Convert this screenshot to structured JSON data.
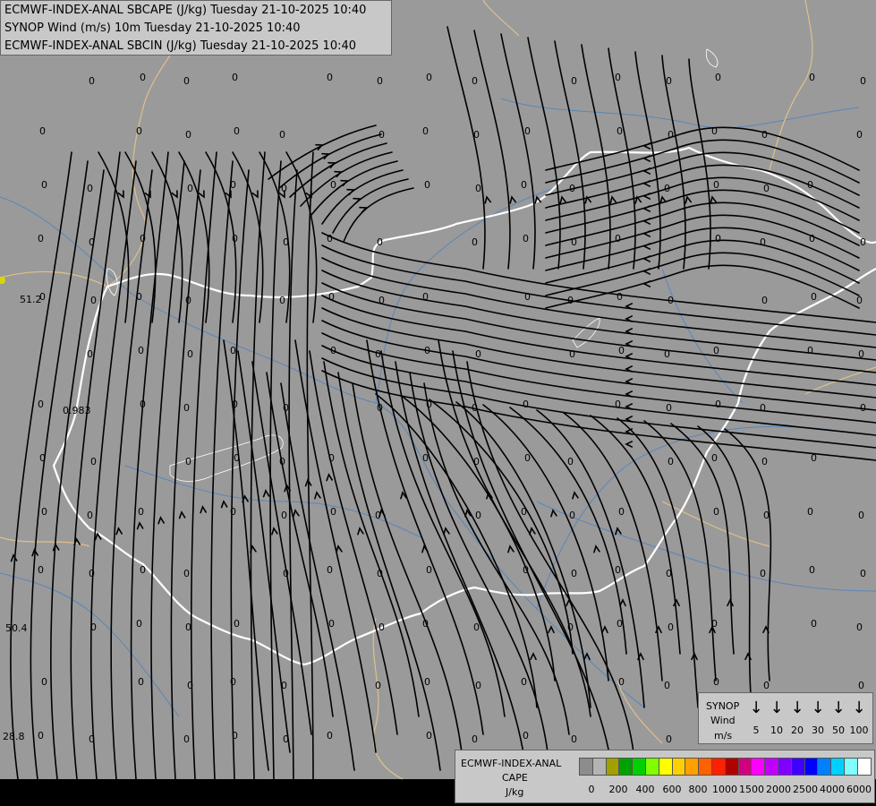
{
  "titles": {
    "line1": "ECMWF-INDEX-ANAL SBCAPE (J/kg) Tuesday 21-10-2025 10:40",
    "line2": "SYNOP Wind (m/s) 10m Tuesday 21-10-2025 10:40",
    "line3": "ECMWF-INDEX-ANAL SBCIN (J/kg) Tuesday 21-10-2025 10:40"
  },
  "colors": {
    "background": "#9a9a9a",
    "streamline": "#000000",
    "border_country": "#ffffff",
    "border_region": "#e0c08a",
    "river": "#5a86b8"
  },
  "station_values": [
    "51.2",
    "0.983",
    "50.4",
    "28.8"
  ],
  "synop_legend": {
    "title_line1": "SYNOP",
    "title_line2": "Wind",
    "unit": "m/s",
    "speeds": [
      "5",
      "10",
      "20",
      "30",
      "50",
      "100"
    ]
  },
  "cape_legend": {
    "title_line1": "ECMWF-INDEX-ANAL",
    "title_line2": "CAPE",
    "unit": "J/kg",
    "colors": [
      "#8c8c8c",
      "#b4b4b4",
      "#a0a000",
      "#00a000",
      "#00d000",
      "#80ff00",
      "#ffff00",
      "#ffd000",
      "#ffa000",
      "#ff6000",
      "#ff2000",
      "#b00000",
      "#d00080",
      "#ff00ff",
      "#c000ff",
      "#8000ff",
      "#4000ff",
      "#0000ff",
      "#0080ff",
      "#00d0ff",
      "#80ffff",
      "#ffffff"
    ],
    "ticks": [
      "0",
      "200",
      "400",
      "600",
      "800",
      "1000",
      "1500",
      "2000",
      "2500",
      "4000",
      "6000"
    ]
  }
}
